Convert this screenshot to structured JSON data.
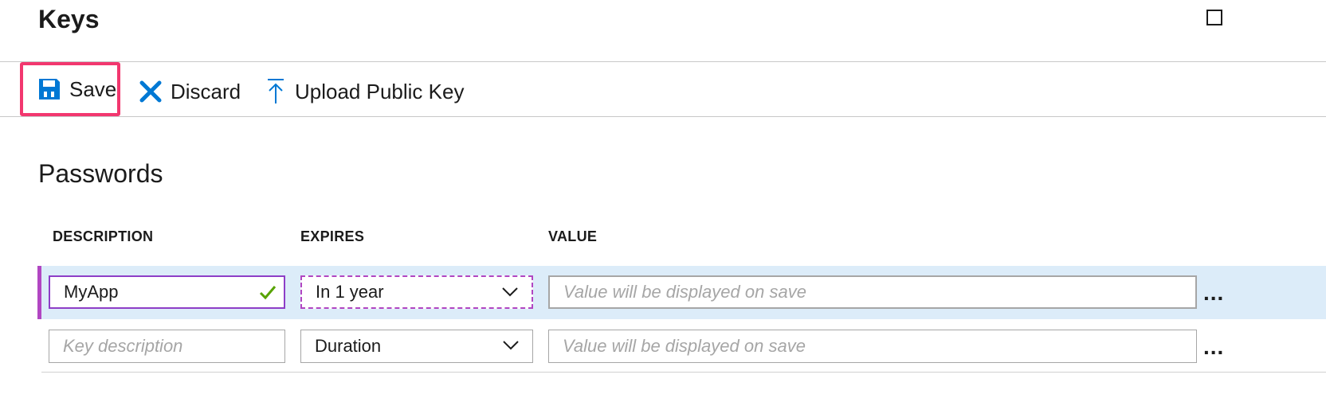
{
  "header": {
    "title": "Keys"
  },
  "toolbar": {
    "save_label": "Save",
    "discard_label": "Discard",
    "upload_label": "Upload Public Key"
  },
  "passwords": {
    "title": "Passwords",
    "columns": [
      "DESCRIPTION",
      "EXPIRES",
      "VALUE"
    ],
    "rows": [
      {
        "description": "MyApp",
        "description_placeholder": "Key description",
        "expires": "In 1 year",
        "value_placeholder": "Value will be displayed on save",
        "more": "..."
      },
      {
        "description": "",
        "description_placeholder": "Key description",
        "expires": "Duration",
        "value_placeholder": "Value will be displayed on save",
        "more": "..."
      }
    ]
  },
  "icons": {
    "save": "floppy-disk-icon",
    "discard": "x-icon",
    "upload": "upload-arrow-icon",
    "valid": "checkmark-icon",
    "dropdown": "chevron-down-icon",
    "maximize": "square-icon"
  },
  "colors": {
    "accent_blue": "#0078d4",
    "highlight_border": "#f2376f",
    "selected_row": "#dcecf9",
    "row_marker": "#b146c2",
    "valid_green": "#57a300"
  }
}
